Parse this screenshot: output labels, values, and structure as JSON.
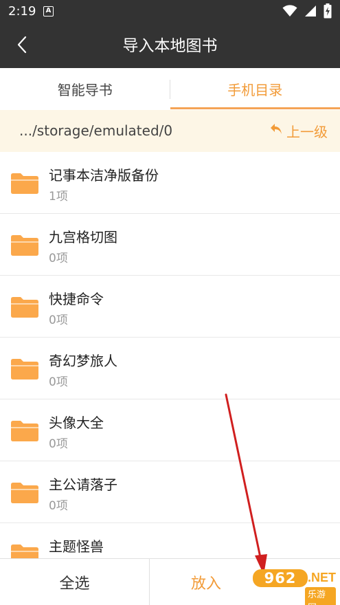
{
  "status_bar": {
    "time": "2:19",
    "notification_icon": "a-letter-icon",
    "icons": [
      "wifi-icon",
      "cellular-signal-icon",
      "battery-charging-icon"
    ]
  },
  "app_bar": {
    "back_icon": "chevron-left-icon",
    "title": "导入本地图书"
  },
  "tabs": [
    {
      "label": "智能导书",
      "active": false
    },
    {
      "label": "手机目录",
      "active": true
    }
  ],
  "path_bar": {
    "path": ".../storage/emulated/0",
    "up_icon": "return-arrow-icon",
    "up_label": "上一级"
  },
  "files": [
    {
      "name": "记事本洁净版备份",
      "count": "1项"
    },
    {
      "name": "九宫格切图",
      "count": "0项"
    },
    {
      "name": "快捷命令",
      "count": "0项"
    },
    {
      "name": "奇幻梦旅人",
      "count": "0项"
    },
    {
      "name": "头像大全",
      "count": "0项"
    },
    {
      "name": "主公请落子",
      "count": "0项"
    },
    {
      "name": "主题怪兽",
      "count": ""
    }
  ],
  "bottom_bar": {
    "select_all": "全选",
    "import": "放入"
  },
  "watermark": {
    "logo": "962",
    "suffix": ".NET",
    "sub": "乐游网"
  },
  "colors": {
    "accent": "#f29b38",
    "folder": "#fba84b",
    "toolbar": "#333333",
    "path_bg": "#fdf6e6",
    "arrow": "#d01f1f"
  }
}
